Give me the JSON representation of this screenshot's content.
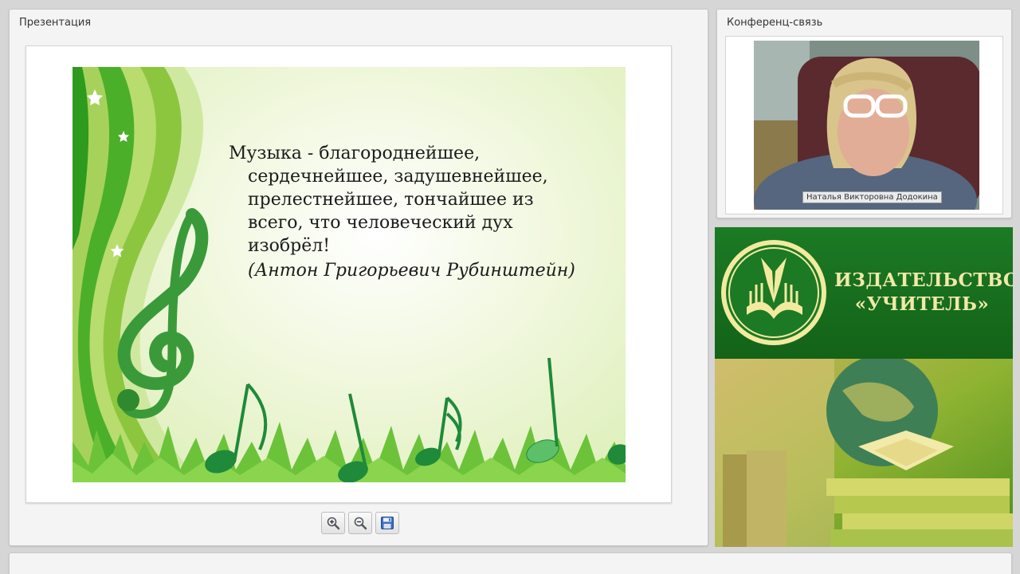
{
  "presentation": {
    "title": "Презентация",
    "slide": {
      "quote_lines": [
        "Музыка - благороднейшее,",
        "сердечнейшее, задушевнейшее,",
        "прелестнейшее, тончайшее из",
        "всего, что человеческий дух",
        "изобрёл!"
      ],
      "author": "(Антон Григорьевич Рубинштейн)"
    },
    "toolbar": {
      "zoom_in": "zoom-in-icon",
      "zoom_out": "zoom-out-icon",
      "save": "save-icon"
    }
  },
  "conference": {
    "title": "Конференц-связь",
    "participant_name": "Наталья Викторовна Додокина"
  },
  "publisher": {
    "name_line1": "ИЗДАТЕЛЬСТВО",
    "name_line2": "«УЧИТЕЛЬ»"
  },
  "colors": {
    "slide_green": "#5cb82e",
    "publisher_green": "#1c7a24",
    "publisher_text": "#f1e9a8"
  }
}
